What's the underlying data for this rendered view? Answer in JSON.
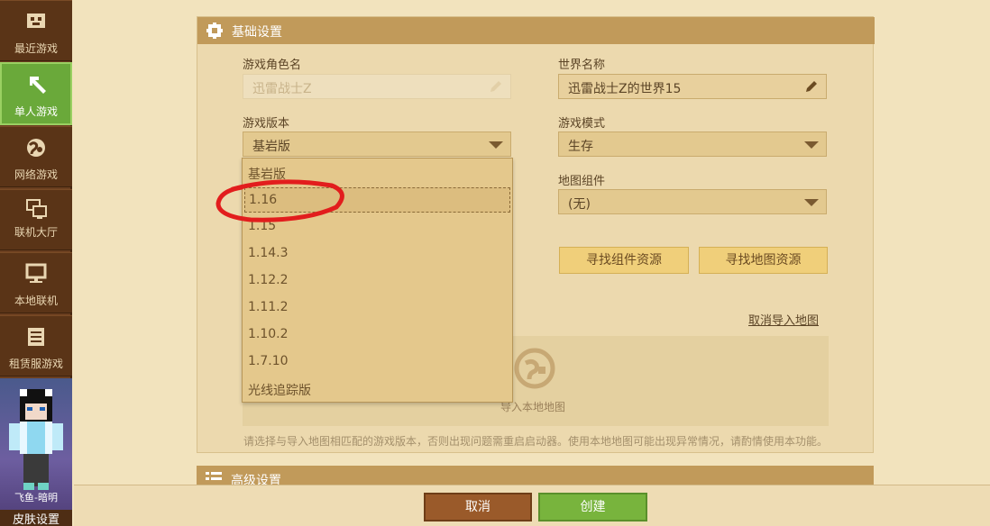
{
  "sidebar": {
    "items": [
      {
        "label": "最近游戏",
        "icon": "gamepad-icon"
      },
      {
        "label": "单人游戏",
        "icon": "pickaxe-icon"
      },
      {
        "label": "网络游戏",
        "icon": "globe-icon"
      },
      {
        "label": "联机大厅",
        "icon": "lobby-icon"
      },
      {
        "label": "本地联机",
        "icon": "monitor-icon"
      },
      {
        "label": "租赁服游戏",
        "icon": "server-icon"
      }
    ],
    "avatar_name": "飞鱼-暗明",
    "skin_button": "皮肤设置"
  },
  "basic_settings": {
    "title": "基础设置",
    "character_label": "游戏角色名",
    "character_placeholder": "迅雷战士Z",
    "world_label": "世界名称",
    "world_value": "迅雷战士Z的世界15",
    "version_label": "游戏版本",
    "version_value": "基岩版",
    "mode_label": "游戏模式",
    "mode_value": "生存",
    "map_component_label": "地图组件",
    "map_component_value": "(无)",
    "find_component_button": "寻找组件资源",
    "find_map_button": "寻找地图资源",
    "cancel_import_link": "取消导入地图",
    "import_label": "导入本地地图",
    "note": "请选择与导入地图相匹配的游戏版本，否则出现问题需重启启动器。使用本地地图可能出现异常情况，请酌情使用本功能。"
  },
  "version_options": [
    "基岩版",
    "1.16",
    "1.15",
    "1.14.3",
    "1.12.2",
    "1.11.2",
    "1.10.2",
    "1.7.10",
    "光线追踪版"
  ],
  "selected_version": "1.16",
  "advanced_settings": {
    "title": "高级设置"
  },
  "footer": {
    "cancel": "取消",
    "create": "创建"
  },
  "colors": {
    "accent_green": "#78b43d",
    "accent_brown": "#9a5a2a",
    "header_tan": "#c19a5a"
  }
}
